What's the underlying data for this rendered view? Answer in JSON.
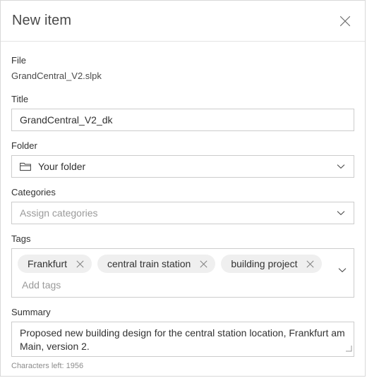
{
  "dialog": {
    "title": "New item",
    "close_icon": "close-icon"
  },
  "file": {
    "label": "File",
    "name": "GrandCentral_V2.slpk"
  },
  "title_field": {
    "label": "Title",
    "value": "GrandCentral_V2_dk"
  },
  "folder_field": {
    "label": "Folder",
    "value": "Your folder",
    "icon": "folder-icon",
    "chevron": "chevron-down-icon"
  },
  "categories_field": {
    "label": "Categories",
    "placeholder": "Assign categories",
    "chevron": "chevron-down-icon"
  },
  "tags_field": {
    "label": "Tags",
    "tags": [
      {
        "label": "Frankfurt",
        "remove_icon": "close-icon"
      },
      {
        "label": "central train station",
        "remove_icon": "close-icon"
      },
      {
        "label": "building project",
        "remove_icon": "close-icon"
      }
    ],
    "placeholder": "Add tags",
    "chevron": "chevron-down-icon"
  },
  "summary_field": {
    "label": "Summary",
    "value": "Proposed new building design for the central station location, Frankfurt am Main, version 2.",
    "characters_left": "Characters left: 1956"
  },
  "colors": {
    "border": "#cccccc",
    "panel_border": "#d8d8d8",
    "text": "#323232",
    "muted_text": "#9a9a9a",
    "chip_bg": "#efefef"
  }
}
